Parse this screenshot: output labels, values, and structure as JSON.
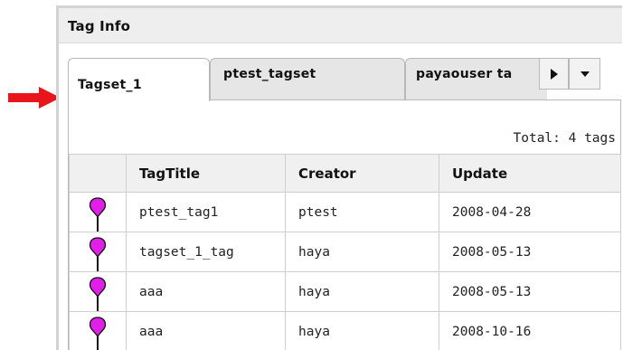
{
  "panel": {
    "title": "Tag Info"
  },
  "tabs": [
    {
      "label": "Tagset_1",
      "active": true
    },
    {
      "label": "ptest_tagset",
      "active": false
    },
    {
      "label": "payaouser ta",
      "active": false
    }
  ],
  "tab_controls": {
    "scroll_right_icon": "triangle-right-icon",
    "menu_icon": "triangle-down-icon"
  },
  "summary": {
    "total_label": "Total: 4 tags"
  },
  "table": {
    "columns": [
      "",
      "TagTitle",
      "Creator",
      "Update"
    ],
    "rows": [
      {
        "marker": "1",
        "title": "ptest_tag1",
        "creator": "ptest",
        "update": "2008-04-28"
      },
      {
        "marker": "2",
        "title": "tagset_1_tag",
        "creator": "haya",
        "update": "2008-05-13"
      },
      {
        "marker": "3",
        "title": "aaa",
        "creator": "haya",
        "update": "2008-05-13"
      },
      {
        "marker": "4",
        "title": "aaa",
        "creator": "haya",
        "update": "2008-10-16"
      }
    ]
  },
  "colors": {
    "pin_fill": "#e020e8",
    "annotation_arrow": "#e8151b",
    "header_bg": "#eeeeee"
  }
}
